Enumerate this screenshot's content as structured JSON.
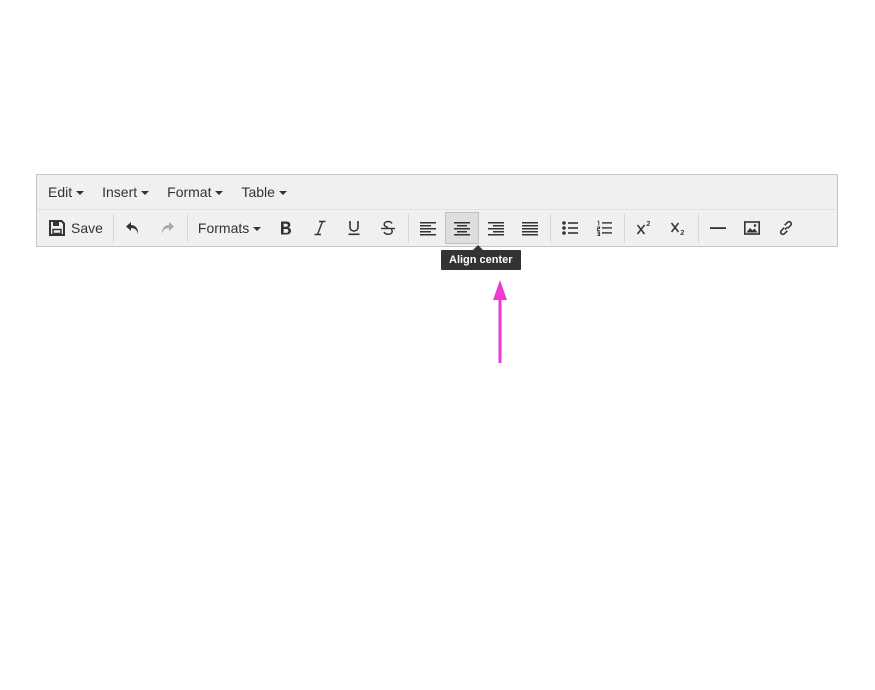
{
  "menubar": {
    "items": [
      {
        "label": "Edit"
      },
      {
        "label": "Insert"
      },
      {
        "label": "Format"
      },
      {
        "label": "Table"
      }
    ]
  },
  "toolbar": {
    "save_label": "Save",
    "formats_label": "Formats",
    "buttons": {
      "save": "floppy-disk-icon",
      "undo": "undo-icon",
      "redo": "redo-icon",
      "bold": "bold-icon",
      "italic": "italic-icon",
      "underline": "underline-icon",
      "strikethrough": "strikethrough-icon",
      "align_left": "align-left-icon",
      "align_center": "align-center-icon",
      "align_right": "align-right-icon",
      "align_justify": "align-justify-icon",
      "bullet_list": "bullet-list-icon",
      "numbered_list": "numbered-list-icon",
      "superscript": "superscript-icon",
      "subscript": "subscript-icon",
      "horizontal_rule": "horizontal-rule-icon",
      "image": "image-icon",
      "link": "link-icon"
    },
    "active_button": "align_center",
    "redo_disabled": true
  },
  "tooltip": {
    "text": "Align center"
  },
  "colors": {
    "toolbar_bg": "#f0f0f0",
    "tooltip_bg": "#333333",
    "annotation_arrow": "#ee3ad0"
  }
}
